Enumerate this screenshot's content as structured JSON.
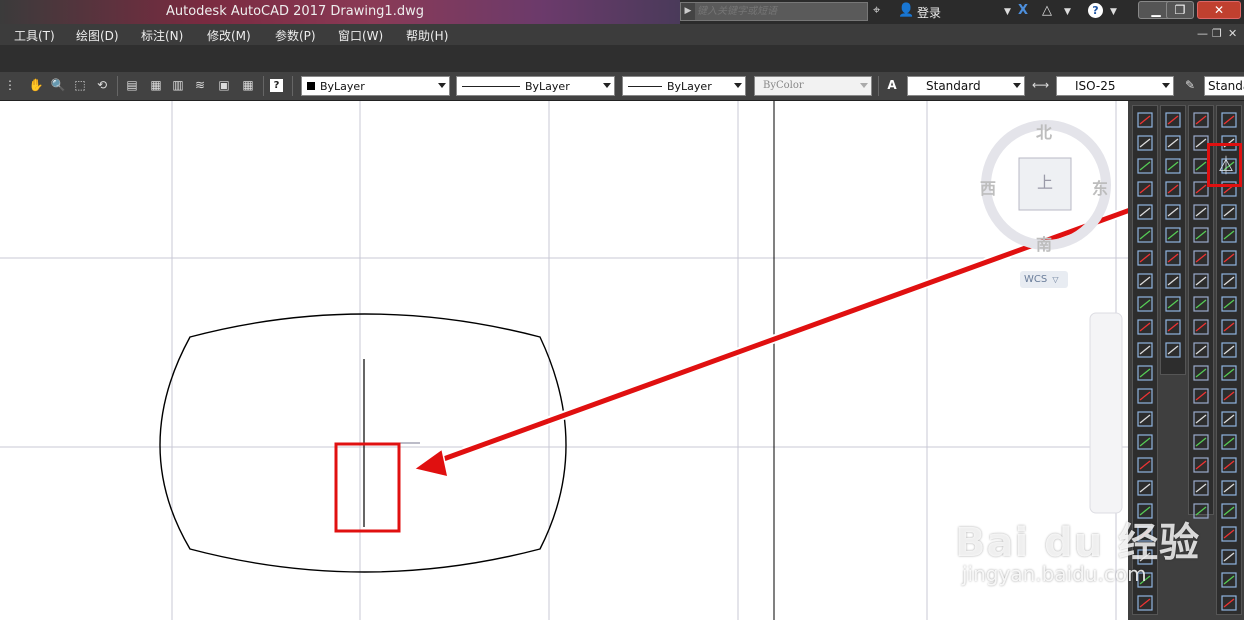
{
  "window": {
    "title": "Autodesk AutoCAD 2017    Drawing1.dwg",
    "search_placeholder": "键入关键字或短语",
    "login_label": "登录",
    "minimize_label": "▁",
    "restore_label": "❐",
    "close_label": "✕"
  },
  "menu": {
    "items": [
      "工具(T)",
      "绘图(D)",
      "标注(N)",
      "修改(M)",
      "参数(P)",
      "窗口(W)",
      "帮助(H)"
    ]
  },
  "toolbar": {
    "layer_color": "ByLayer",
    "linetype": "ByLayer",
    "lineweight": "ByLayer",
    "plot_style": "ByColor",
    "text_style": "Standard",
    "dim_style": "ISO-25",
    "table_style": "Standard"
  },
  "viewcube": {
    "north": "北",
    "south": "南",
    "east": "东",
    "west": "西",
    "face": "上",
    "wcs": "WCS"
  },
  "watermark": {
    "brand": "Bai du 经验",
    "url": "jingyan.baidu.com"
  },
  "colors": {
    "annotation_red": "#e01010",
    "drawing_stroke": "#000000",
    "grid_line": "#c9c9d6",
    "panel_dark": "#3f3f3f"
  },
  "icons": {
    "search_arrow": "chevron-right-icon",
    "binoculars": "binoculars-icon",
    "user": "user-icon",
    "exchange": "exchange-x-icon",
    "a360": "a360-icon",
    "help": "help-icon",
    "mirror": "mirror-icon"
  }
}
